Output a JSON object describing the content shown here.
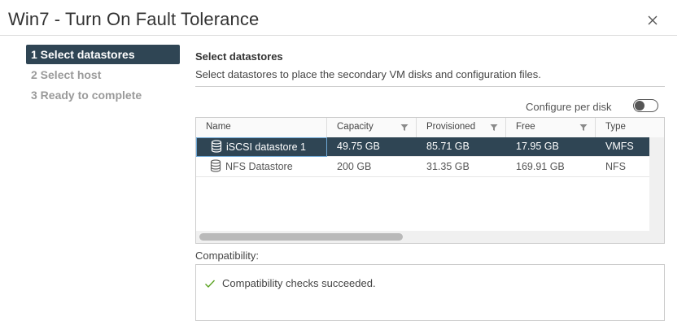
{
  "dialog": {
    "title": "Win7 - Turn On Fault Tolerance",
    "close_icon": "close-icon"
  },
  "steps": [
    {
      "label": "1 Select datastores",
      "active": true
    },
    {
      "label": "2 Select host",
      "active": false
    },
    {
      "label": "3 Ready to complete",
      "active": false
    }
  ],
  "main": {
    "section_title": "Select datastores",
    "section_desc": "Select datastores to place the secondary VM disks and configuration files.",
    "configure_per_disk": {
      "label": "Configure per disk",
      "enabled": false
    },
    "grid": {
      "columns": [
        {
          "label": "Name",
          "filter": false
        },
        {
          "label": "Capacity",
          "filter": true
        },
        {
          "label": "Provisioned",
          "filter": true
        },
        {
          "label": "Free",
          "filter": true
        },
        {
          "label": "Type",
          "filter": false
        }
      ],
      "rows": [
        {
          "name": "iSCSI datastore 1",
          "capacity": "49.75 GB",
          "provisioned": "85.71 GB",
          "free": "17.95 GB",
          "type": "VMFS",
          "selected": true
        },
        {
          "name": "NFS Datastore",
          "capacity": "200 GB",
          "provisioned": "31.35 GB",
          "free": "169.91 GB",
          "type": "NFS",
          "selected": false
        }
      ]
    },
    "compatibility": {
      "label": "Compatibility:",
      "message": "Compatibility checks succeeded.",
      "status_icon": "check-icon",
      "status_color": "#5aa220"
    }
  },
  "colors": {
    "accent": "#2f4554",
    "selection_outline": "#6fa8d6"
  }
}
